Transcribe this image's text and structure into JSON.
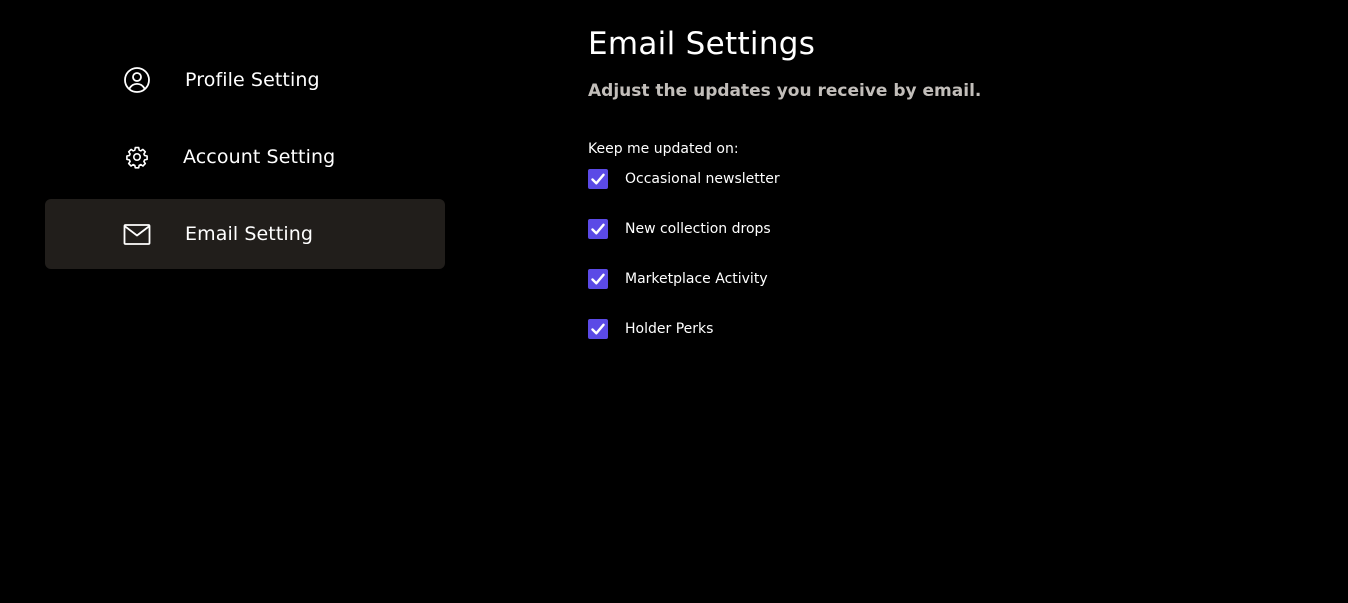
{
  "sidebar": {
    "items": [
      {
        "label": "Profile Setting",
        "icon": "user-circle-icon",
        "active": false
      },
      {
        "label": "Account Setting",
        "icon": "gear-icon",
        "active": false
      },
      {
        "label": "Email Setting",
        "icon": "mail-icon",
        "active": true
      }
    ]
  },
  "main": {
    "title": "Email Settings",
    "subtitle": "Adjust the updates you receive by email.",
    "group_label": "Keep me updated on:",
    "options": [
      {
        "label": "Occasional newsletter",
        "checked": true
      },
      {
        "label": "New collection drops",
        "checked": true
      },
      {
        "label": "Marketplace Activity",
        "checked": true
      },
      {
        "label": "Holder Perks",
        "checked": true
      }
    ]
  },
  "colors": {
    "background": "#000000",
    "active_nav_bg": "#211e1b",
    "checkbox_accent": "#5b4ae6",
    "subtitle_text": "#c2beba"
  }
}
